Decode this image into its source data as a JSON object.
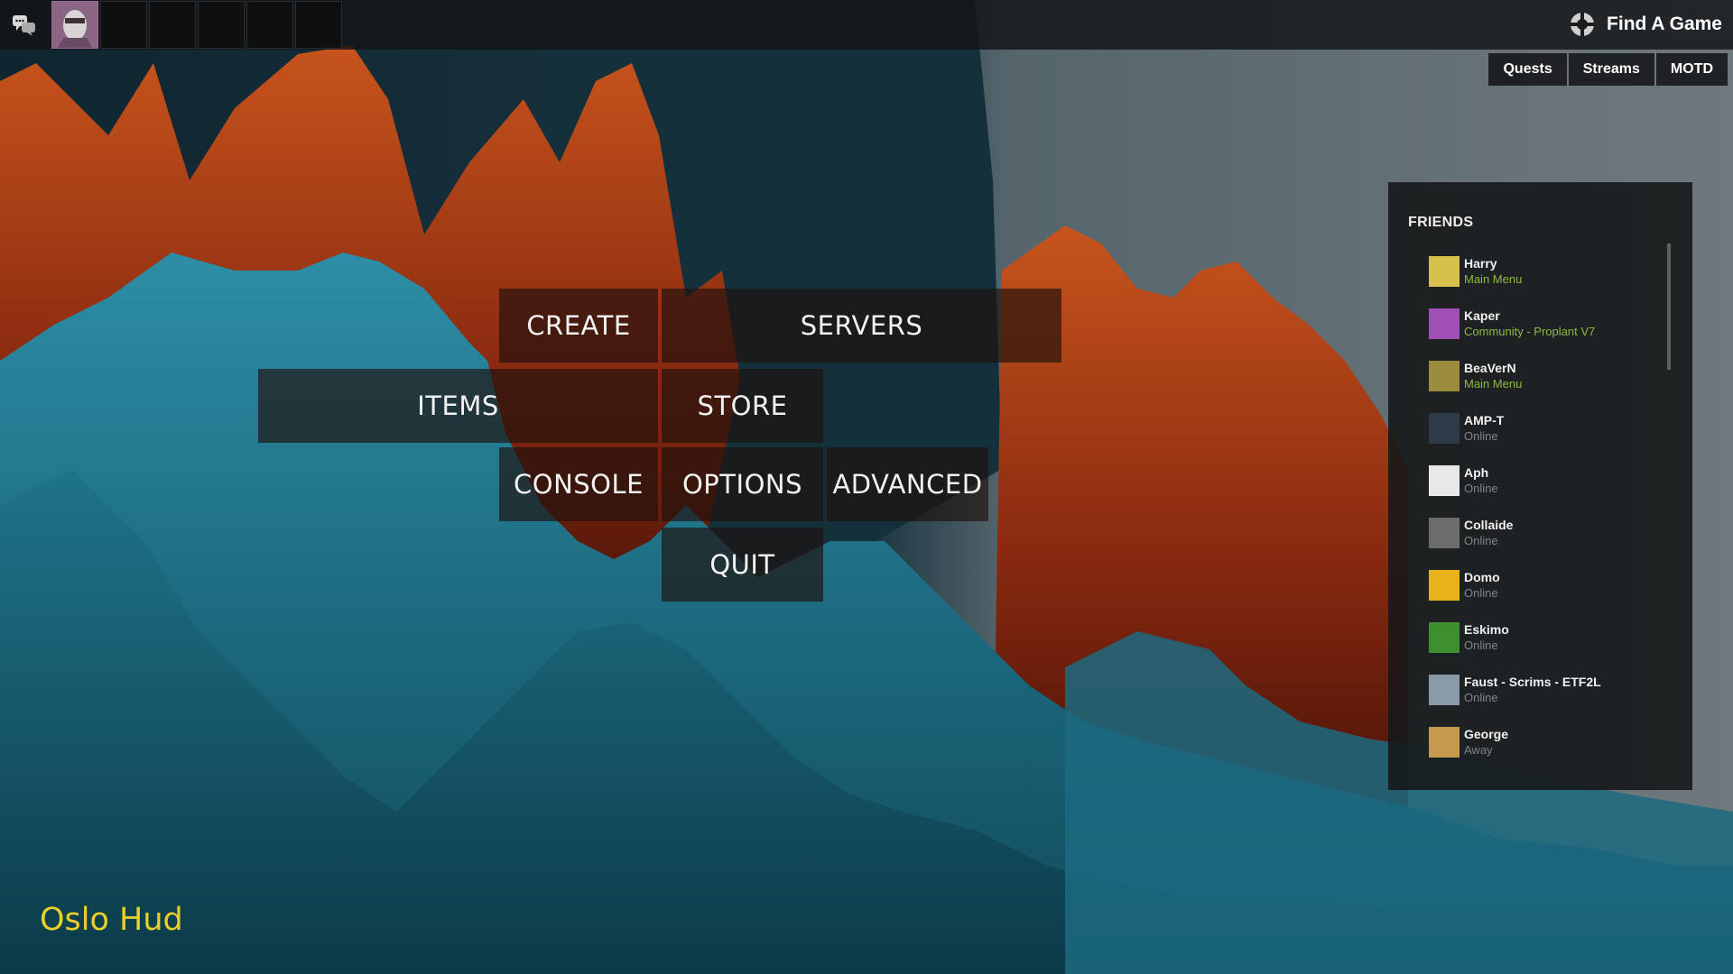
{
  "hud": {
    "name": "Oslo Hud",
    "name_color": "#e9cf2b"
  },
  "topbar": {
    "chat_icon": "chat-bubbles-icon",
    "loadout_slots": 6,
    "active_slot": 1,
    "find_game_icon": "tf2-logo-icon",
    "find_game_label": "Find A Game"
  },
  "tabs": [
    {
      "label": "Quests"
    },
    {
      "label": "Streams"
    },
    {
      "label": "MOTD"
    }
  ],
  "menu": {
    "create": "CREATE",
    "servers": "SERVERS",
    "items": "ITEMS",
    "store": "STORE",
    "console": "CONSOLE",
    "options": "OPTIONS",
    "advanced": "ADVANCED",
    "quit": "QUIT"
  },
  "friends": {
    "title": "FRIENDS",
    "list": [
      {
        "name": "Harry",
        "status": "Main Menu",
        "status_color": "#8fb93f",
        "avatar_color": "#d8c14a"
      },
      {
        "name": "Kaper",
        "status": "Community - Proplant V7",
        "status_color": "#8fb93f",
        "avatar_color": "#a04fb6"
      },
      {
        "name": "BeaVerN",
        "status": "Main Menu",
        "status_color": "#8fb93f",
        "avatar_color": "#9a8e3e"
      },
      {
        "name": "AMP-T",
        "status": "Online",
        "status_color": "#7d858a",
        "avatar_color": "#2f3a48"
      },
      {
        "name": "Aph",
        "status": "Online",
        "status_color": "#7d858a",
        "avatar_color": "#e8e8e8"
      },
      {
        "name": "Collaide",
        "status": "Online",
        "status_color": "#7d858a",
        "avatar_color": "#6c6c6c"
      },
      {
        "name": "Domo",
        "status": "Online",
        "status_color": "#7d858a",
        "avatar_color": "#e8b21a"
      },
      {
        "name": "Eskimo",
        "status": "Online",
        "status_color": "#7d858a",
        "avatar_color": "#3e8f2e"
      },
      {
        "name": "Faust - Scrims - ETF2L",
        "status": "Online",
        "status_color": "#7d858a",
        "avatar_color": "#8a9aa8"
      },
      {
        "name": "George",
        "status": "Away",
        "status_color": "#7d858a",
        "avatar_color": "#c59a4c"
      }
    ]
  }
}
